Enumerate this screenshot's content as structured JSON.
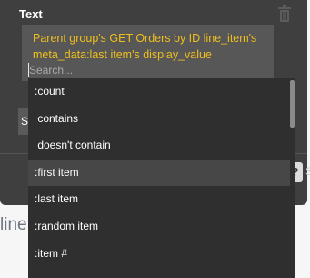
{
  "panel": {
    "title": "Text",
    "expression": "Parent group's GET Orders by ID line_item's meta_data:last item's display_value",
    "search_placeholder": "Search...",
    "obscured_row_label": "S",
    "help_label": "?",
    "help_side_letter": "S"
  },
  "background": {
    "heading": "line"
  },
  "dropdown": {
    "items": [
      ":count",
      " contains",
      " doesn't contain",
      ":first item",
      ":last item",
      ":random item",
      ":item #"
    ],
    "highlighted_index": 3
  },
  "colors": {
    "panel_bg": "#3f3f3f",
    "expression_text": "#f0bf1e",
    "dropdown_bg": "#2f2f2f",
    "highlight_bg": "#474747"
  }
}
